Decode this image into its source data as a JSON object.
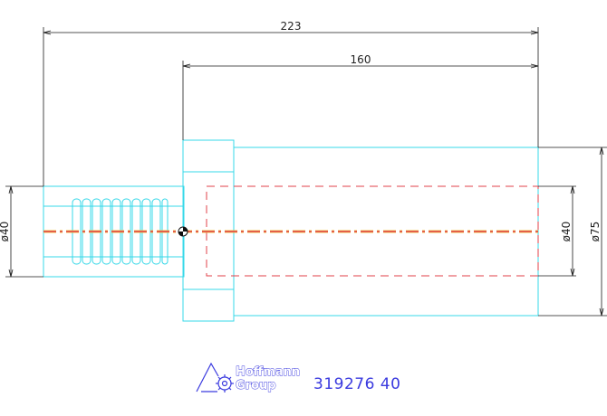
{
  "drawing": {
    "dimensions": {
      "overall_length": "223",
      "body_length": "160",
      "shank_diameter": "ø40",
      "bore_diameter": "ø40",
      "body_diameter": "ø75"
    },
    "logo": {
      "line1": "Hoffmann",
      "line2": "Group",
      "icon": "hoffmann-logo-icon"
    },
    "part_number": "319276 40",
    "colors": {
      "outline": "#37d8e8",
      "centerline": "#e0404a",
      "centerline_inner": "#f0c040",
      "dimension": "#1a1a1a",
      "brand": "#3a3adf"
    }
  }
}
